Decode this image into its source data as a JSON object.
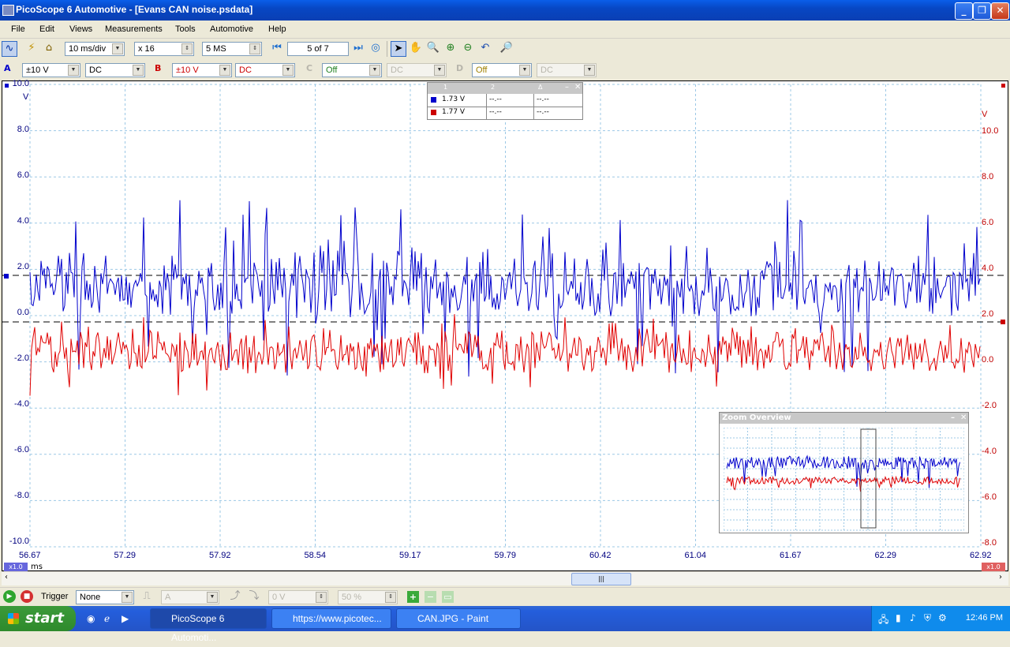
{
  "window": {
    "title": "PicoScope 6 Automotive - [Evans CAN noise.psdata]"
  },
  "menu": [
    "File",
    "Edit",
    "Views",
    "Measurements",
    "Tools",
    "Automotive",
    "Help"
  ],
  "toolbar": {
    "timebase": "10 ms/div",
    "zoom": "x 16",
    "samples": "5 MS",
    "buffer": "5 of 7"
  },
  "channels": [
    {
      "name": "A",
      "range": "±10 V",
      "coupling": "DC",
      "color": "#0000CC"
    },
    {
      "name": "B",
      "range": "±10 V",
      "coupling": "DC",
      "color": "#CC0000"
    },
    {
      "name": "C",
      "range": "Off",
      "coupling": "DC"
    },
    {
      "name": "D",
      "range": "Off",
      "coupling": "DC"
    }
  ],
  "axes": {
    "left_unit": "V",
    "right_unit": "V",
    "x_unit": "ms",
    "left_ticks": [
      "10.0",
      "8.0",
      "6.0",
      "4.0",
      "2.0",
      "0.0",
      "-2.0",
      "-4.0",
      "-6.0",
      "-8.0",
      "-10.0"
    ],
    "right_ticks": [
      "10.0",
      "8.0",
      "6.0",
      "4.0",
      "2.0",
      "0.0",
      "-2.0",
      "-4.0",
      "-6.0",
      "-8.0"
    ],
    "x_ticks": [
      "56.67",
      "57.29",
      "57.92",
      "58.54",
      "59.17",
      "59.79",
      "60.42",
      "61.04",
      "61.67",
      "62.29",
      "62.92"
    ],
    "left_scale_badge": "x1.0",
    "right_scale_badge": "x1.0"
  },
  "rulers": {
    "headers": [
      "1",
      "2",
      "Δ"
    ],
    "rows": [
      {
        "v1": "1.73 V",
        "v2": "--.--",
        "delta": "--.--",
        "color": "#0000CC"
      },
      {
        "v1": "1.77 V",
        "v2": "--.--",
        "delta": "--.--",
        "color": "#CC0000"
      }
    ]
  },
  "zoom_overview": {
    "title": "Zoom Overview"
  },
  "trigger": {
    "label": "Trigger",
    "mode": "None",
    "source": "A",
    "threshold": "0 V",
    "pre_trigger": "50 %"
  },
  "taskbar": {
    "start": "start",
    "tasks": [
      "PicoScope 6 Automoti...",
      "https://www.picotec...",
      "CAN.JPG - Paint"
    ],
    "clock": "12:46 PM"
  }
}
